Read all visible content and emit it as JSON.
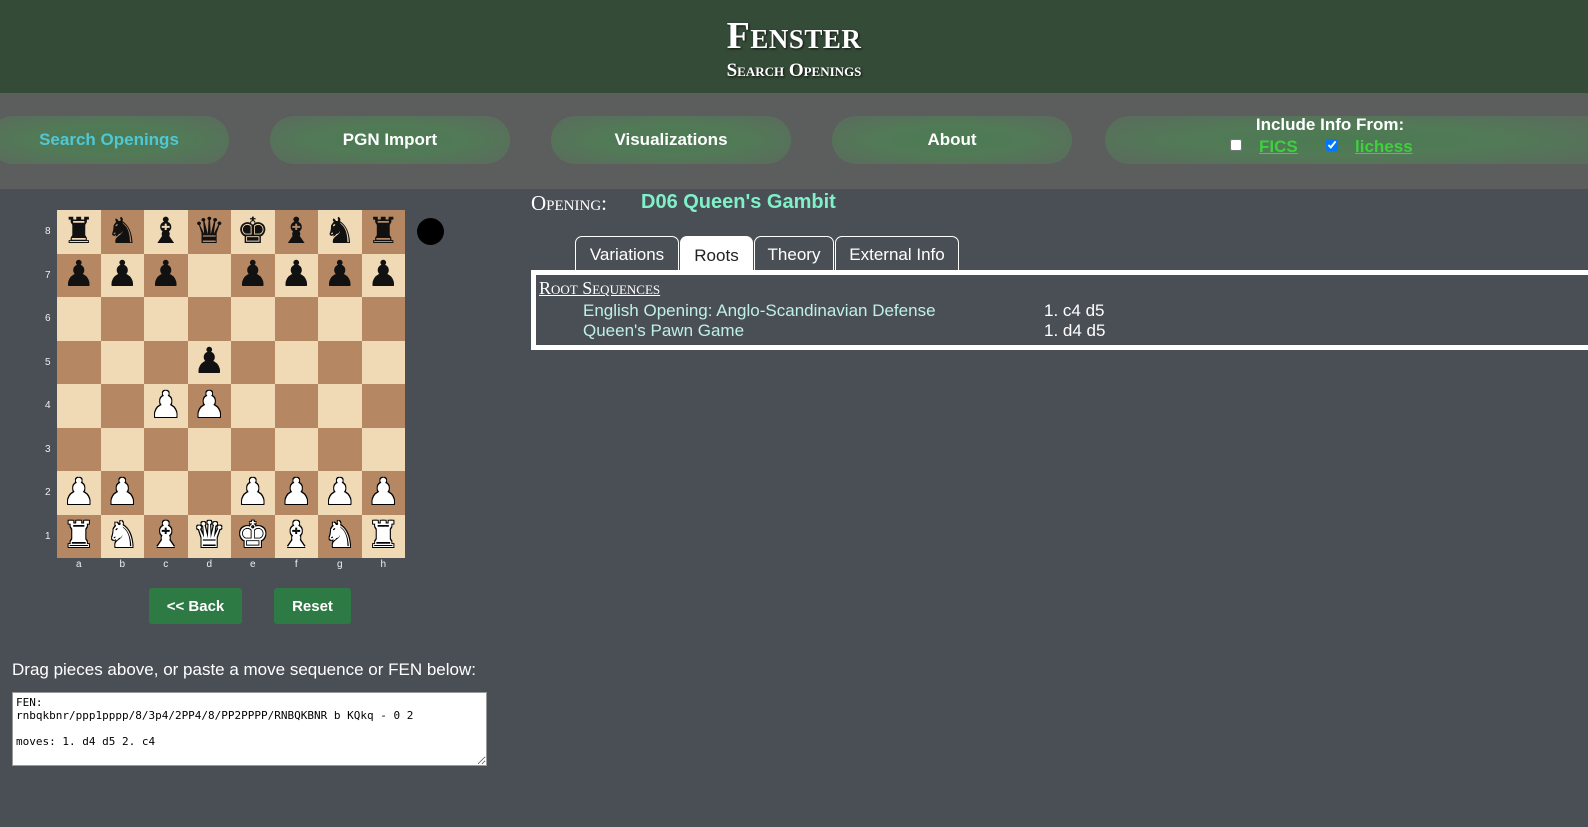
{
  "header": {
    "title": "Fenster",
    "subtitle": "Search Openings"
  },
  "nav": {
    "items": [
      {
        "label": "Search Openings",
        "active": true
      },
      {
        "label": "PGN Import"
      },
      {
        "label": "Visualizations"
      },
      {
        "label": "About"
      }
    ],
    "include": {
      "title": "Include Info From:",
      "sources": [
        {
          "label": "FICS",
          "checked": false
        },
        {
          "label": "lichess",
          "checked": true
        }
      ]
    }
  },
  "board": {
    "ranks": [
      "8",
      "7",
      "6",
      "5",
      "4",
      "3",
      "2",
      "1"
    ],
    "files": [
      "a",
      "b",
      "c",
      "d",
      "e",
      "f",
      "g",
      "h"
    ],
    "position": [
      [
        "r",
        "n",
        "b",
        "q",
        "k",
        "b",
        "n",
        "r"
      ],
      [
        "p",
        "p",
        "p",
        "",
        "p",
        "p",
        "p",
        "p"
      ],
      [
        "",
        "",
        "",
        "",
        "",
        "",
        "",
        ""
      ],
      [
        "",
        "",
        "",
        "p",
        "",
        "",
        "",
        ""
      ],
      [
        "",
        "",
        "P",
        "P",
        "",
        "",
        "",
        ""
      ],
      [
        "",
        "",
        "",
        "",
        "",
        "",
        "",
        ""
      ],
      [
        "P",
        "P",
        "",
        "",
        "P",
        "P",
        "P",
        "P"
      ],
      [
        "R",
        "N",
        "B",
        "Q",
        "K",
        "B",
        "N",
        "R"
      ]
    ],
    "turn_color": "black"
  },
  "controls": {
    "back_label": "<< Back",
    "reset_label": "Reset"
  },
  "input": {
    "instruction": "Drag pieces above, or paste a move sequence or FEN below:",
    "value": "FEN:\nrnbqkbnr/ppp1pppp/8/3p4/2PP4/8/PP2PPPP/RNBQKBNR b KQkq - 0 2\n\nmoves: 1. d4 d5 2. c4"
  },
  "opening": {
    "label": "Opening:",
    "name": "D06 Queen's Gambit"
  },
  "tabs": [
    {
      "label": "Variations"
    },
    {
      "label": "Roots",
      "active": true
    },
    {
      "label": "Theory"
    },
    {
      "label": "External Info"
    }
  ],
  "roots": {
    "title": "Root Sequences",
    "items": [
      {
        "name": "English Opening: Anglo-Scandinavian Defense",
        "moves": "1. c4 d5"
      },
      {
        "name": "Queen's Pawn Game",
        "moves": "1. d4 d5"
      }
    ]
  },
  "colors": {
    "header_bg": "#344b37",
    "accent_link": "#3fcf3f",
    "active_nav": "#4fc8d6",
    "opening_name": "#7ff0c8",
    "button": "#2e7a44"
  }
}
